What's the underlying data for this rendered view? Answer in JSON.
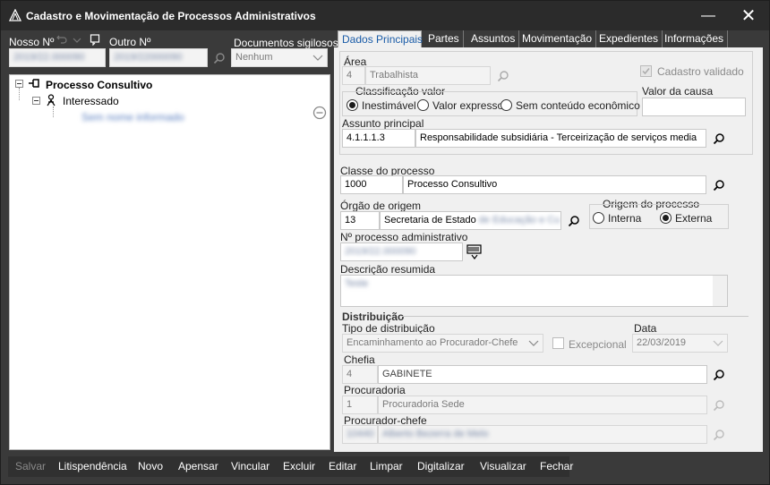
{
  "window": {
    "title": "Cadastro e Movimentação de Processos Administrativos",
    "minimize": "—",
    "maximize": "☐",
    "close": "✕"
  },
  "header": {
    "nosso_label": "Nosso Nº",
    "nosso_value": "2019/22.000090",
    "outro_label": "Outro Nº",
    "outro_value": "2019/22000090",
    "docs_label": "Documentos sigilosos",
    "docs_value": "Nenhum"
  },
  "tree": {
    "root": "Processo Consultivo",
    "child": "Interessado",
    "leaf": "Sem nome informado"
  },
  "tabs": [
    "Dados Principais",
    "Partes",
    "Assuntos",
    "Movimentação",
    "Expedientes",
    "Informações"
  ],
  "area": {
    "label": "Área",
    "code": "4",
    "name": "Trabalhista"
  },
  "cadastro_validado": "Cadastro validado",
  "classificacao": {
    "label": "Classificação valor",
    "options": [
      "Inestimável",
      "Valor expresso",
      "Sem conteúdo econômico"
    ],
    "selected": 0
  },
  "valor_causa": {
    "label": "Valor da causa",
    "value": ""
  },
  "assunto": {
    "label": "Assunto principal",
    "code": "4.1.1.1.3",
    "name": "Responsabilidade subsidiária - Terceirização de serviços media"
  },
  "classe": {
    "label": "Classe do processo",
    "code": "1000",
    "name": "Processo Consultivo"
  },
  "orgao": {
    "label": "Órgão de origem",
    "code": "13",
    "name": "Secretaria de Estado",
    "name_hidden": "de Educação e Cu"
  },
  "origem": {
    "label": "Origem do processo",
    "options": [
      "Interna",
      "Externa"
    ],
    "selected": 1
  },
  "num_adm": {
    "label": "Nº processo administrativo",
    "value": "2019/22.000090"
  },
  "descricao": {
    "label": "Descrição resumida",
    "value": "Teste"
  },
  "distribuicao": {
    "label": "Distribuição",
    "tipo_label": "Tipo de distribuição",
    "tipo_value": "Encaminhamento ao Procurador-Chefe",
    "excepcional": "Excepcional",
    "data_label": "Data",
    "data_value": "22/03/2019"
  },
  "chefia": {
    "label": "Chefia",
    "code": "4",
    "name": "GABINETE"
  },
  "procuradoria": {
    "label": "Procuradoria",
    "code": "1",
    "name": "Procuradoria Sede"
  },
  "procurador": {
    "label": "Procurador-chefe",
    "code": "10440",
    "name": "Alberto Bezerra de Melo"
  },
  "toolbar": {
    "salvar": "Salvar",
    "litis": "Litispendência",
    "novo": "Novo",
    "apensar": "Apensar",
    "vincular": "Vincular",
    "excluir": "Excluir",
    "editar": "Editar",
    "limpar": "Limpar",
    "digitalizar": "Digitalizar",
    "visualizar": "Visualizar",
    "fechar": "Fechar"
  },
  "colors": {
    "titlebar": "#2b2b2b",
    "window": "#3a3a3a",
    "panel": "#f0f0f0",
    "active_tab": "#1a5ca8"
  }
}
